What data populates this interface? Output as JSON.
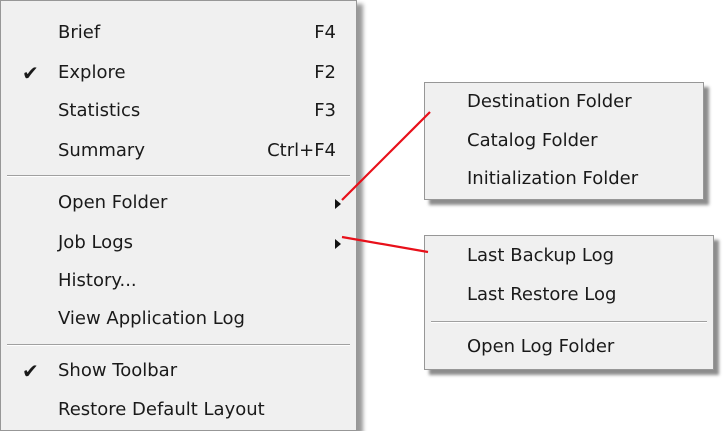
{
  "main_menu": {
    "items": [
      {
        "label": "Brief",
        "shortcut": "F4",
        "checked": false
      },
      {
        "label": "Explore",
        "shortcut": "F2",
        "checked": true
      },
      {
        "label": "Statistics",
        "shortcut": "F3",
        "checked": false
      },
      {
        "label": "Summary",
        "shortcut": "Ctrl+F4",
        "checked": false
      },
      {
        "label": "Open Folder",
        "has_submenu": true
      },
      {
        "label": "Job Logs",
        "has_submenu": true
      },
      {
        "label": "History..."
      },
      {
        "label": "View Application Log"
      },
      {
        "label": "Show Toolbar",
        "checked": true
      },
      {
        "label": "Restore Default Layout"
      }
    ],
    "check_glyph": "✔"
  },
  "open_folder_submenu": {
    "items": [
      {
        "label": "Destination Folder"
      },
      {
        "label": "Catalog Folder"
      },
      {
        "label": "Initialization Folder"
      }
    ]
  },
  "job_logs_submenu": {
    "items": [
      {
        "label": "Last Backup Log"
      },
      {
        "label": "Last Restore Log"
      },
      {
        "label": "Open Log Folder"
      }
    ]
  },
  "colors": {
    "menu_background": "#f0f0f0",
    "pointer_line": "#e8101a"
  }
}
